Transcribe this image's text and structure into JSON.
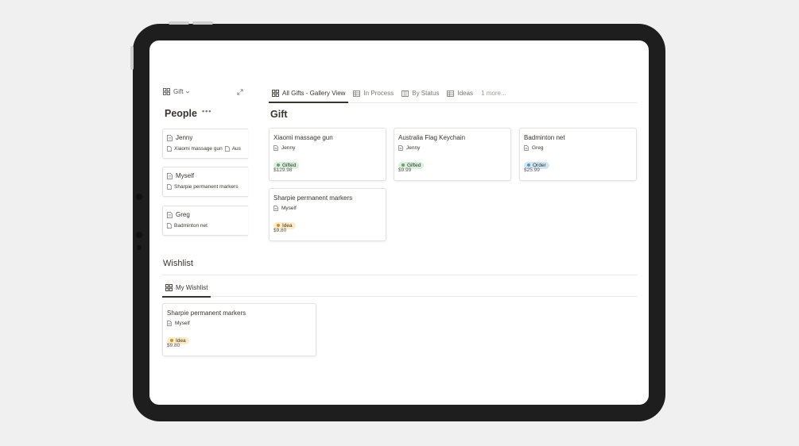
{
  "left_panel": {
    "view_label": "Gift",
    "title": "People",
    "people": [
      {
        "name": "Jenny",
        "links": [
          "Xiaomi massage gun",
          "Aus"
        ]
      },
      {
        "name": "Myself",
        "links": [
          "Sharpie permanent markers"
        ]
      },
      {
        "name": "Greg",
        "links": [
          "Badminton net"
        ]
      }
    ]
  },
  "gift_section": {
    "tabs": [
      {
        "label": "All Gifts - Gallery View",
        "icon": "gallery-icon",
        "active": true
      },
      {
        "label": "In Process",
        "icon": "table-icon",
        "active": false
      },
      {
        "label": "By Status",
        "icon": "board-icon",
        "active": false
      },
      {
        "label": "Ideas",
        "icon": "table-icon",
        "active": false
      }
    ],
    "more_label": "1 more...",
    "title": "Gift",
    "cards": [
      {
        "title": "Xiaomi massage gun",
        "person": "Jenny",
        "status": "Gifted",
        "price": "$129.98"
      },
      {
        "title": "Australia Flag Keychain",
        "person": "Jenny",
        "status": "Gifted",
        "price": "$9.99"
      },
      {
        "title": "Badminton net",
        "person": "Greg",
        "status": "Order",
        "price": "$25.99"
      },
      {
        "title": "Sharpie permanent markers",
        "person": "Myself",
        "status": "Idea",
        "price": "$9.80"
      }
    ]
  },
  "wishlist": {
    "title": "Wishlist",
    "tab_label": "My Wishlist",
    "card": {
      "title": "Sharpie permanent markers",
      "person": "Myself",
      "status": "Idea",
      "price": "$9.80"
    }
  },
  "colors": {
    "gifted_bg": "#dbeddb",
    "gifted_dot": "#6c9b7d",
    "order_bg": "#d3e5ef",
    "order_dot": "#5b97bd",
    "idea_bg": "#fdecc8",
    "idea_dot": "#cb912f"
  }
}
